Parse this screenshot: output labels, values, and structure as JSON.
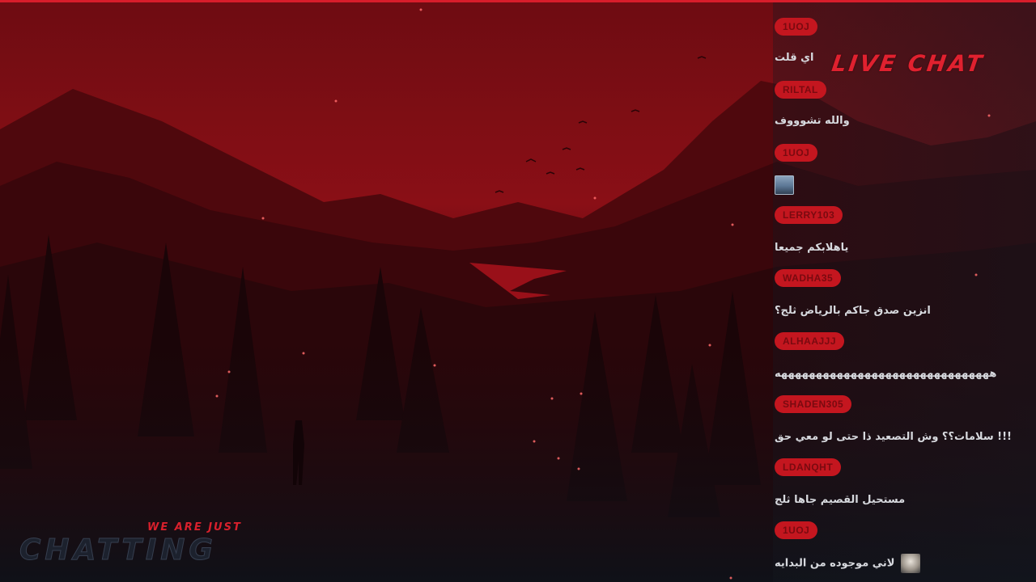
{
  "overlay": {
    "live_chat_title": "LIVE CHAT",
    "brand_small": "WE ARE JUST",
    "brand_big": "CHATTING",
    "accent_color": "#d81d2b"
  },
  "chat": {
    "messages": [
      {
        "user": "1UOJ",
        "text": "اي قلت"
      },
      {
        "user": "RILTAL",
        "text": "والله تشوووف"
      },
      {
        "user": "1UOJ",
        "emote": "avatar-emote"
      },
      {
        "user": "LERRY103",
        "text": "ياهلابكم جميعا"
      },
      {
        "user": "WADHA35",
        "text": "انزين صدق جاكم بالرياض ثلج؟"
      },
      {
        "user": "ALHAAJJJ",
        "text": "هههههههههههههههههههههههههههههههه"
      },
      {
        "user": "SHADEN305",
        "text": "سلامات؟؟ وش التصعيد ذا حتى لو معي حق !!!"
      },
      {
        "user": "LDANQHT",
        "text": "مستحيل القصيم جاها ثلج"
      },
      {
        "user": "1UOJ",
        "text": "لاني موجوده من البدايه",
        "emote": "sticker-emote"
      }
    ]
  }
}
